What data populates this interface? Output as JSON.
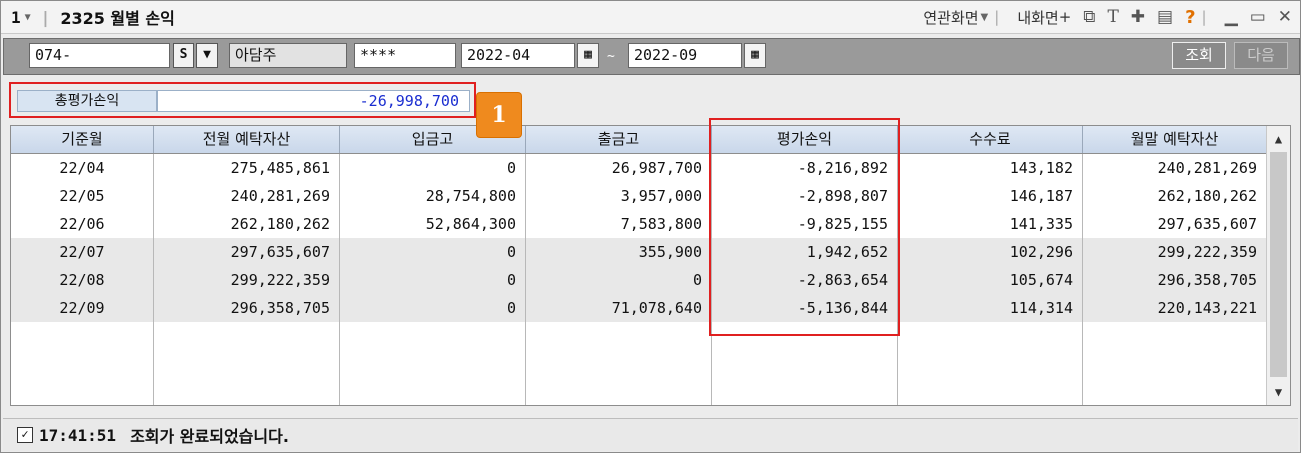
{
  "titlebar": {
    "window_number": "1",
    "title": "2325 월별 손익",
    "related_screen": "연관화면",
    "internal_screen": "내화면",
    "plus": "+"
  },
  "toolbar": {
    "account_number": "074-",
    "account_type": "S",
    "account_name": "아담주",
    "password": "****",
    "date_from": "2022-04",
    "range_sep": "~",
    "date_to": "2022-09",
    "query_button": "조회",
    "next_button": "다음"
  },
  "summary": {
    "label": "총평가손익",
    "value": "-26,998,700"
  },
  "badge": "1",
  "table": {
    "headers": [
      "기준월",
      "전월 예탁자산",
      "입금고",
      "출금고",
      "평가손익",
      "수수료",
      "월말 예탁자산"
    ],
    "rows": [
      [
        "22/04",
        "275,485,861",
        "0",
        "26,987,700",
        "-8,216,892",
        "143,182",
        "240,281,269"
      ],
      [
        "22/05",
        "240,281,269",
        "28,754,800",
        "3,957,000",
        "-2,898,807",
        "146,187",
        "262,180,262"
      ],
      [
        "22/06",
        "262,180,262",
        "52,864,300",
        "7,583,800",
        "-9,825,155",
        "141,335",
        "297,635,607"
      ],
      [
        "22/07",
        "297,635,607",
        "0",
        "355,900",
        "1,942,652",
        "102,296",
        "299,222,359"
      ],
      [
        "22/08",
        "299,222,359",
        "0",
        "0",
        "-2,863,654",
        "105,674",
        "296,358,705"
      ],
      [
        "22/09",
        "296,358,705",
        "0",
        "71,078,640",
        "-5,136,844",
        "114,314",
        "220,143,221"
      ]
    ]
  },
  "status": {
    "time": "17:41:51",
    "message": "조회가 완료되었습니다."
  },
  "colors": {
    "highlight_box": "#e02020",
    "badge": "#ef8a1e",
    "summary_value": "#1a2dd0"
  }
}
